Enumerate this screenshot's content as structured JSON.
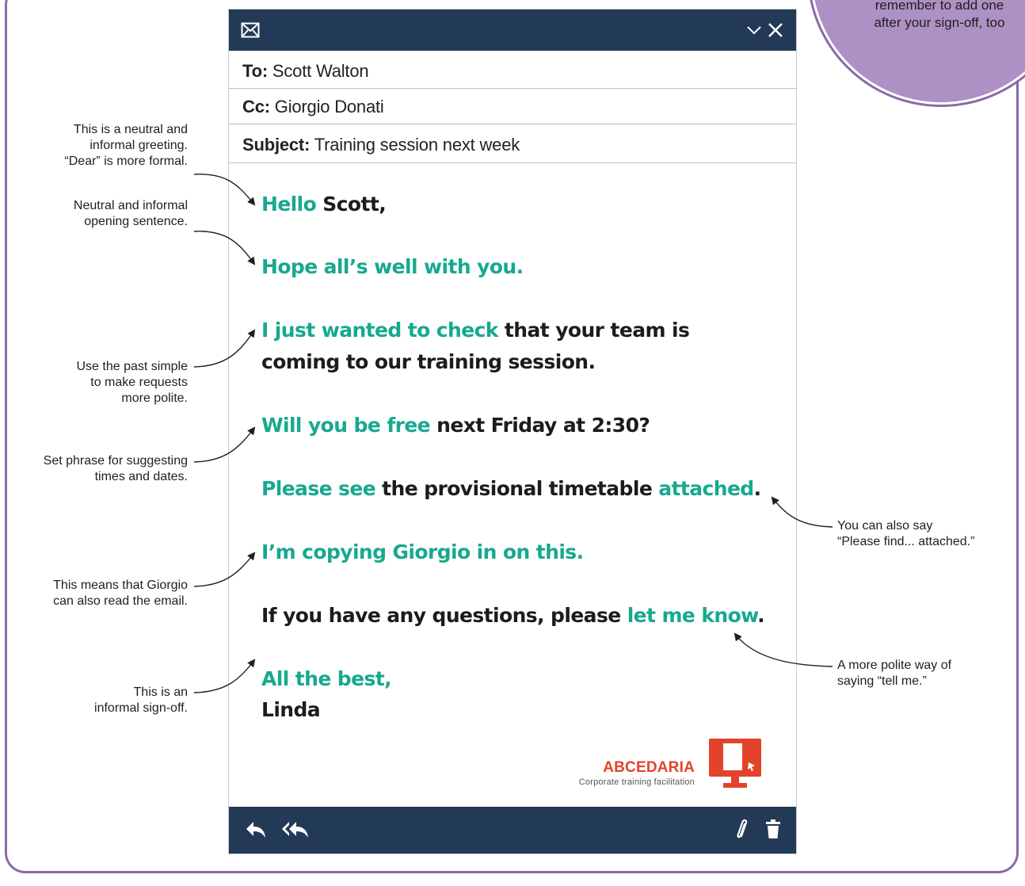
{
  "circle_note": {
    "lines": [
      "remember to add one",
      "after your sign-off, too"
    ]
  },
  "window": {
    "title_icon": "envelope-icon",
    "title_actions": [
      "chevron-down-icon",
      "close-icon"
    ],
    "to_label": "To:",
    "to_value": "Scott Walton",
    "cc_label": "Cc:",
    "cc_value": "Giorgio Donati",
    "subject_label": "Subject:",
    "subject_value": "Training session next week"
  },
  "email": {
    "greeting_hl": "Hello",
    "greeting_rest": " Scott,",
    "opening": "Hope all’s well with you.",
    "check_hl": "I just wanted to check",
    "check_rest": " that your team is",
    "check_line2": "coming to our training session.",
    "free_hl": "Will you be free",
    "free_rest": " next Friday at 2:30?",
    "see_hl": "Please see",
    "see_mid": " the provisional timetable ",
    "see_hl2": "attached",
    "see_end": ".",
    "copy": "I’m copying Giorgio in on this.",
    "q_rest": "If you have any questions, please ",
    "q_hl": "let me know",
    "q_end": ".",
    "signoff": "All the best,",
    "name": "Linda"
  },
  "logo": {
    "name": "ABCEDARIA",
    "tagline": "Corporate training facilitation",
    "icon": "monitor-icon",
    "accent": "#e3432a"
  },
  "footer": {
    "left_icons": [
      "reply-icon",
      "reply-all-icon"
    ],
    "right_icons": [
      "paperclip-icon",
      "trash-icon"
    ]
  },
  "annotations": {
    "greeting": [
      "This is a neutral and",
      "informal greeting.",
      "“Dear” is more formal."
    ],
    "opening": [
      "Neutral and informal",
      "opening sentence."
    ],
    "past_simple": [
      "Use the past simple",
      "to make requests",
      "more polite."
    ],
    "set_phrase": [
      "Set phrase for suggesting",
      "times and dates."
    ],
    "copying": [
      "This means that Giorgio",
      "can also read the email."
    ],
    "signoff": [
      "This is an",
      "informal sign-off."
    ],
    "attached": [
      "You can also say",
      "“Please find... attached.”"
    ],
    "let_me_know": [
      "A more polite way of",
      "saying “tell me.”"
    ]
  },
  "colors": {
    "highlight": "#17a98f",
    "window_bar": "#223a55",
    "frame": "#8a6aa6",
    "circle": "#ad90c4"
  }
}
